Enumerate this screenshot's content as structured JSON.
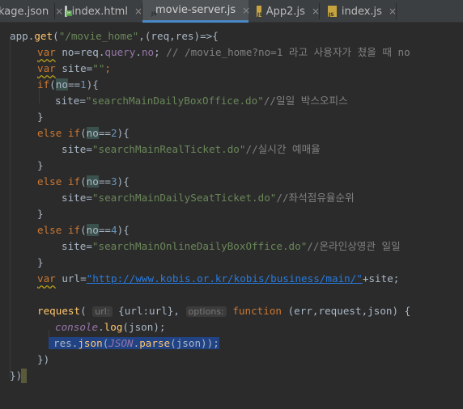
{
  "tabs": [
    {
      "label": "kage.json",
      "icon": "json-file-icon",
      "active": false
    },
    {
      "label": "index.html",
      "icon": "html-file-icon",
      "active": false
    },
    {
      "label": "movie-server.js",
      "icon": "js-file-icon",
      "active": true
    },
    {
      "label": "App2.js",
      "icon": "js-file-icon",
      "active": false
    },
    {
      "label": "index.js",
      "icon": "js-file-icon",
      "active": false
    }
  ],
  "code": {
    "l1_a": "app.",
    "l1_get": "get",
    "l1_b": "(",
    "l1_str": "\"/movie_home\"",
    "l1_c": ",(req,res)=>{",
    "l2_var": "var",
    "l2_a": " no=req.",
    "l2_query": "query",
    "l2_b": ".",
    "l2_no": "no",
    "l2_c": "; ",
    "l2_cmt": "// /movie_home?no=1 라고 사용자가 쳤을 때 no",
    "l3_var": "var",
    "l3_a": " site=",
    "l3_str": "\"\"",
    "l3_b": ";",
    "l4_if": "if",
    "l4_a": "(",
    "l4_no": "no",
    "l4_eq": "==",
    "l4_num": "1",
    "l4_b": "){",
    "l5_a": "site=",
    "l5_str": "\"searchMainDailyBoxOffice.do\"",
    "l5_cmt": "//일일 박스오피스",
    "l6": "}",
    "l7_kw": "else if",
    "l7_a": "(",
    "l7_no": "no",
    "l7_eq": "==",
    "l7_num": "2",
    "l7_b": "){",
    "l8_a": "site=",
    "l8_str": "\"searchMainRealTicket.do\"",
    "l8_cmt": "//실시간 예매율",
    "l9": "}",
    "l10_kw": "else if",
    "l10_a": "(",
    "l10_no": "no",
    "l10_eq": "==",
    "l10_num": "3",
    "l10_b": "){",
    "l11_a": "site=",
    "l11_str": "\"searchMainDailySeatTicket.do\"",
    "l11_cmt": "//좌석점유율순위",
    "l12": "}",
    "l13_kw": "else if",
    "l13_a": "(",
    "l13_no": "no",
    "l13_eq": "==",
    "l13_num": "4",
    "l13_b": "){",
    "l14_a": "site=",
    "l14_str": "\"searchMainOnlineDailyBoxOffice.do\"",
    "l14_cmt": "//온라인상영관 일일",
    "l15": "}",
    "l16_var": "var",
    "l16_a": " url=",
    "l16_url": "\"http://www.kobis.or.kr/kobis/business/main/\"",
    "l16_b": "+site;",
    "l18_fn": "request",
    "l18_a": "(",
    "l18_hint1": "url:",
    "l18_b": " {url:url}, ",
    "l18_hint2": "options:",
    "l18_func": " function",
    "l18_c": " (err,request,json) {",
    "l19_console": "console",
    "l19_a": ".",
    "l19_log": "log",
    "l19_b": "(json);",
    "l20_a": "res.",
    "l20_json": "json",
    "l20_b": "(",
    "l20_JSON": "JSON",
    "l20_c": ".",
    "l20_parse": "parse",
    "l20_d": "(json));",
    "l21": "})",
    "l22": "})"
  },
  "colors": {
    "background": "#2b2b2b",
    "keyword": "#cc7832",
    "string": "#6a8759",
    "number": "#6897bb",
    "comment": "#808080",
    "selection": "#214283",
    "active_tab_accent": "#4a88c7"
  }
}
